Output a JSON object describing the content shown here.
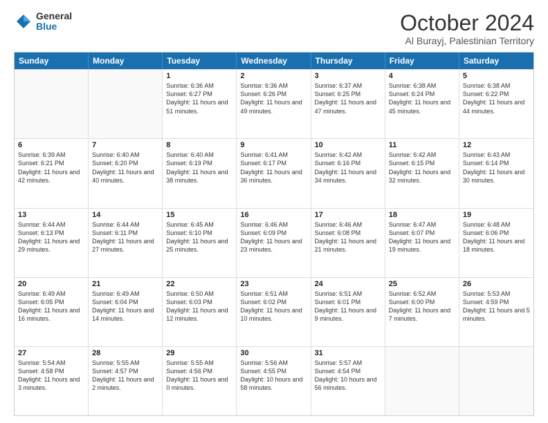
{
  "logo": {
    "general": "General",
    "blue": "Blue"
  },
  "title": "October 2024",
  "location": "Al Burayj, Palestinian Territory",
  "header_days": [
    "Sunday",
    "Monday",
    "Tuesday",
    "Wednesday",
    "Thursday",
    "Friday",
    "Saturday"
  ],
  "rows": [
    [
      {
        "day": "",
        "content": ""
      },
      {
        "day": "",
        "content": ""
      },
      {
        "day": "1",
        "content": "Sunrise: 6:36 AM\nSunset: 6:27 PM\nDaylight: 11 hours and 51 minutes."
      },
      {
        "day": "2",
        "content": "Sunrise: 6:36 AM\nSunset: 6:26 PM\nDaylight: 11 hours and 49 minutes."
      },
      {
        "day": "3",
        "content": "Sunrise: 6:37 AM\nSunset: 6:25 PM\nDaylight: 11 hours and 47 minutes."
      },
      {
        "day": "4",
        "content": "Sunrise: 6:38 AM\nSunset: 6:24 PM\nDaylight: 11 hours and 45 minutes."
      },
      {
        "day": "5",
        "content": "Sunrise: 6:38 AM\nSunset: 6:22 PM\nDaylight: 11 hours and 44 minutes."
      }
    ],
    [
      {
        "day": "6",
        "content": "Sunrise: 6:39 AM\nSunset: 6:21 PM\nDaylight: 11 hours and 42 minutes."
      },
      {
        "day": "7",
        "content": "Sunrise: 6:40 AM\nSunset: 6:20 PM\nDaylight: 11 hours and 40 minutes."
      },
      {
        "day": "8",
        "content": "Sunrise: 6:40 AM\nSunset: 6:19 PM\nDaylight: 11 hours and 38 minutes."
      },
      {
        "day": "9",
        "content": "Sunrise: 6:41 AM\nSunset: 6:17 PM\nDaylight: 11 hours and 36 minutes."
      },
      {
        "day": "10",
        "content": "Sunrise: 6:42 AM\nSunset: 6:16 PM\nDaylight: 11 hours and 34 minutes."
      },
      {
        "day": "11",
        "content": "Sunrise: 6:42 AM\nSunset: 6:15 PM\nDaylight: 11 hours and 32 minutes."
      },
      {
        "day": "12",
        "content": "Sunrise: 6:43 AM\nSunset: 6:14 PM\nDaylight: 11 hours and 30 minutes."
      }
    ],
    [
      {
        "day": "13",
        "content": "Sunrise: 6:44 AM\nSunset: 6:13 PM\nDaylight: 11 hours and 29 minutes."
      },
      {
        "day": "14",
        "content": "Sunrise: 6:44 AM\nSunset: 6:11 PM\nDaylight: 11 hours and 27 minutes."
      },
      {
        "day": "15",
        "content": "Sunrise: 6:45 AM\nSunset: 6:10 PM\nDaylight: 11 hours and 25 minutes."
      },
      {
        "day": "16",
        "content": "Sunrise: 6:46 AM\nSunset: 6:09 PM\nDaylight: 11 hours and 23 minutes."
      },
      {
        "day": "17",
        "content": "Sunrise: 6:46 AM\nSunset: 6:08 PM\nDaylight: 11 hours and 21 minutes."
      },
      {
        "day": "18",
        "content": "Sunrise: 6:47 AM\nSunset: 6:07 PM\nDaylight: 11 hours and 19 minutes."
      },
      {
        "day": "19",
        "content": "Sunrise: 6:48 AM\nSunset: 6:06 PM\nDaylight: 11 hours and 18 minutes."
      }
    ],
    [
      {
        "day": "20",
        "content": "Sunrise: 6:49 AM\nSunset: 6:05 PM\nDaylight: 11 hours and 16 minutes."
      },
      {
        "day": "21",
        "content": "Sunrise: 6:49 AM\nSunset: 6:04 PM\nDaylight: 11 hours and 14 minutes."
      },
      {
        "day": "22",
        "content": "Sunrise: 6:50 AM\nSunset: 6:03 PM\nDaylight: 11 hours and 12 minutes."
      },
      {
        "day": "23",
        "content": "Sunrise: 6:51 AM\nSunset: 6:02 PM\nDaylight: 11 hours and 10 minutes."
      },
      {
        "day": "24",
        "content": "Sunrise: 6:51 AM\nSunset: 6:01 PM\nDaylight: 11 hours and 9 minutes."
      },
      {
        "day": "25",
        "content": "Sunrise: 6:52 AM\nSunset: 6:00 PM\nDaylight: 11 hours and 7 minutes."
      },
      {
        "day": "26",
        "content": "Sunrise: 5:53 AM\nSunset: 4:59 PM\nDaylight: 11 hours and 5 minutes."
      }
    ],
    [
      {
        "day": "27",
        "content": "Sunrise: 5:54 AM\nSunset: 4:58 PM\nDaylight: 11 hours and 3 minutes."
      },
      {
        "day": "28",
        "content": "Sunrise: 5:55 AM\nSunset: 4:57 PM\nDaylight: 11 hours and 2 minutes."
      },
      {
        "day": "29",
        "content": "Sunrise: 5:55 AM\nSunset: 4:56 PM\nDaylight: 11 hours and 0 minutes."
      },
      {
        "day": "30",
        "content": "Sunrise: 5:56 AM\nSunset: 4:55 PM\nDaylight: 10 hours and 58 minutes."
      },
      {
        "day": "31",
        "content": "Sunrise: 5:57 AM\nSunset: 4:54 PM\nDaylight: 10 hours and 56 minutes."
      },
      {
        "day": "",
        "content": ""
      },
      {
        "day": "",
        "content": ""
      }
    ]
  ]
}
